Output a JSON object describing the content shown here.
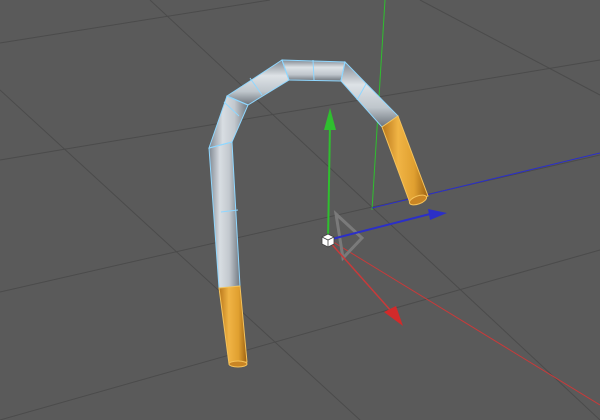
{
  "viewport": {
    "kind": "3d-perspective",
    "background_color": "#5a5a5a",
    "grid_color": "#4b4b4b",
    "axis_colors": {
      "x": "#cc2b2b",
      "y": "#2fbf2f",
      "z": "#2b2fc8"
    },
    "selection_color": "#8fd7ff",
    "object": {
      "type": "bent-tube",
      "body_color": "#bcc3cb",
      "end_color": "#e3a12c"
    },
    "manipulator": {
      "type": "move-gizmo",
      "center_handle_icon": "cube-icon",
      "plane_handle_icon": "triangle-handle-icon"
    }
  }
}
